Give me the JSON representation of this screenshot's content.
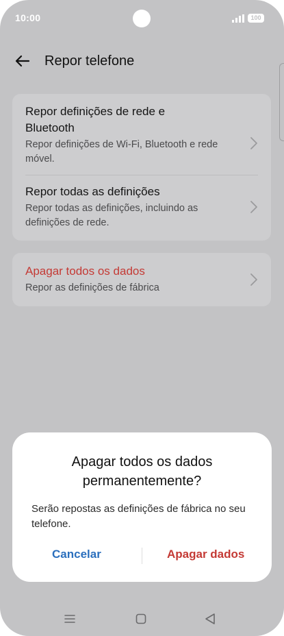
{
  "status_bar": {
    "time": "10:00",
    "battery": "100",
    "icons": [
      "signal-icon",
      "battery-icon"
    ]
  },
  "header": {
    "title": "Repor telefone",
    "back_icon": "back-arrow-icon"
  },
  "settings": {
    "items": [
      {
        "title": "Repor definições de rede e Bluetooth",
        "subtitle": "Repor definições de Wi-Fi, Bluetooth e rede móvel."
      },
      {
        "title": "Repor todas as definições",
        "subtitle": "Repor todas as definições, incluindo as definições de rede."
      },
      {
        "title": "Apagar todos os dados",
        "subtitle": "Repor as definições de fábrica"
      }
    ]
  },
  "dialog": {
    "title": "Apagar todos os dados permanentemente?",
    "body": "Serão repostas as definições de fábrica no seu telefone.",
    "cancel_label": "Cancelar",
    "confirm_label": "Apagar dados"
  },
  "colors": {
    "accent_blue": "#2b6fbd",
    "danger_red": "#c43a35",
    "dim_background": "#c3c3c5"
  },
  "nav_bar": {
    "icons": [
      "menu-icon",
      "home-icon",
      "back-icon"
    ]
  }
}
